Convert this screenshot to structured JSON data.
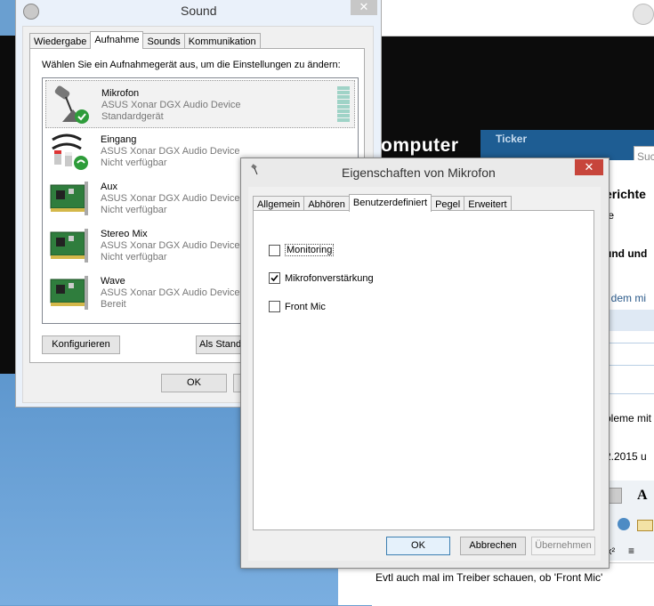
{
  "sound": {
    "title": "Sound",
    "tabs": [
      "Wiedergabe",
      "Aufnahme",
      "Sounds",
      "Kommunikation"
    ],
    "instruction": "Wählen Sie ein Aufnahmegerät aus, um die Einstellungen zu ändern:",
    "devices": [
      {
        "name": "Mikrofon",
        "desc": "ASUS Xonar DGX Audio Device",
        "status": "Standardgerät",
        "icon": "microphone-icon"
      },
      {
        "name": "Eingang",
        "desc": "ASUS Xonar DGX Audio Device",
        "status": "Nicht verfügbar",
        "icon": "rca-cable-icon"
      },
      {
        "name": "Aux",
        "desc": "ASUS Xonar DGX Audio Device",
        "status": "Nicht verfügbar",
        "icon": "sound-card-icon"
      },
      {
        "name": "Stereo Mix",
        "desc": "ASUS Xonar DGX Audio Device",
        "status": "Nicht verfügbar",
        "icon": "sound-card-icon"
      },
      {
        "name": "Wave",
        "desc": "ASUS Xonar DGX Audio Device",
        "status": "Bereit",
        "icon": "sound-card-icon"
      }
    ],
    "configure_label": "Konfigurieren",
    "set_default_label": "Als Stand",
    "ok_label": "OK"
  },
  "props": {
    "title": "Eigenschaften von Mikrofon",
    "tabs": [
      "Allgemein",
      "Abhören",
      "Benutzerdefiniert",
      "Pegel",
      "Erweitert"
    ],
    "options": [
      {
        "label": "Monitoring",
        "checked": false
      },
      {
        "label": "Mikrofonverstärkung",
        "checked": true
      },
      {
        "label": "Front Mic",
        "checked": false
      }
    ],
    "ok_label": "OK",
    "cancel_label": "Abbrechen",
    "apply_label": "Übernehmen"
  },
  "website": {
    "logo": "omputer",
    "ticker": "Ticker",
    "search_placeholder": "Suc",
    "lines": [
      "erichte",
      "fe",
      "und und",
      "t dem mi",
      "bleme mit",
      "2.2015 u"
    ],
    "reply_text": "Evtl auch mal im Treiber schauen, ob 'Front Mic'"
  },
  "colors": {
    "accent": "#3c7fb1",
    "close_red": "#c7453b",
    "level_meter": "#9fd3c7"
  }
}
